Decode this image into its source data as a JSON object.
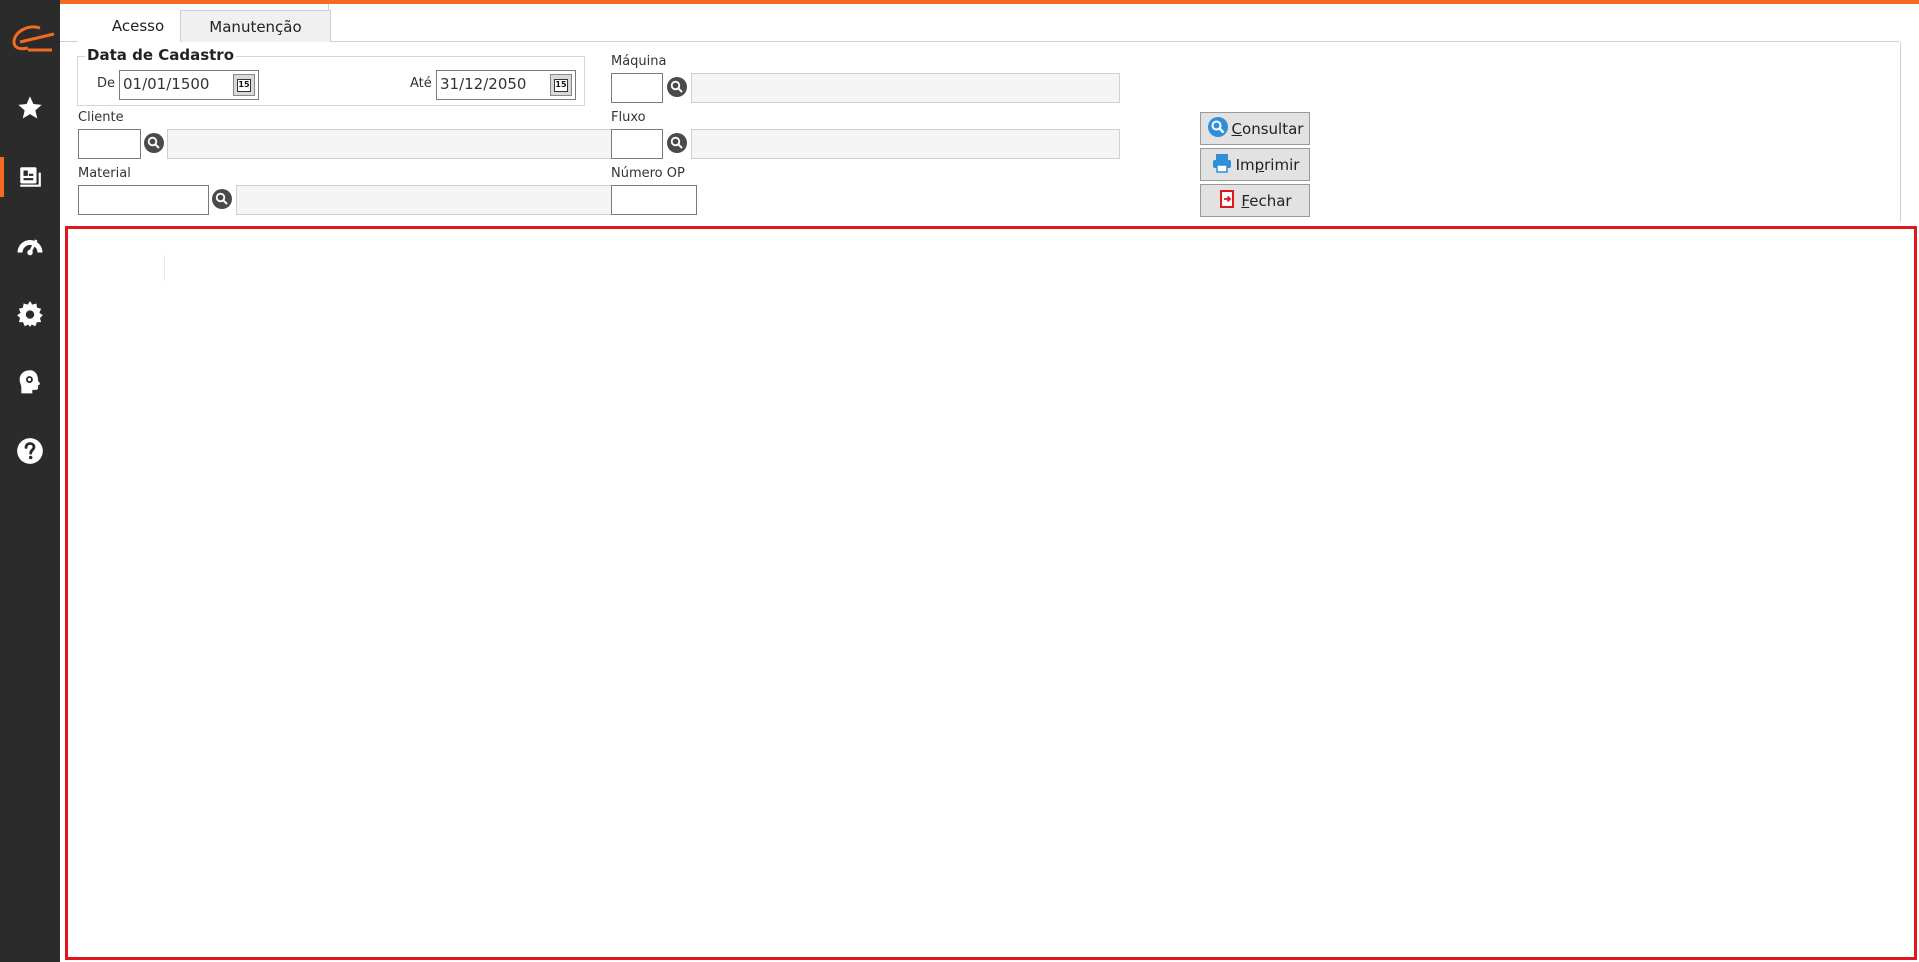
{
  "tabs": [
    {
      "label": "Acesso",
      "active": true
    },
    {
      "label": "Manutenção",
      "active": false
    }
  ],
  "filters": {
    "data_cadastro": {
      "group_label": "Data de Cadastro",
      "de_label": "De",
      "de_value": "01/01/1500",
      "ate_label": "Até",
      "ate_value": "31/12/2050"
    },
    "cliente": {
      "label": "Cliente",
      "code": "",
      "description": ""
    },
    "material": {
      "label": "Material",
      "code": "",
      "description": ""
    },
    "maquina": {
      "label": "Máquina",
      "code": "",
      "description": ""
    },
    "fluxo": {
      "label": "Fluxo",
      "code": "",
      "description": ""
    },
    "numero_op": {
      "label": "Número OP",
      "value": ""
    }
  },
  "actions": {
    "consultar": {
      "label": "Consultar",
      "mnemonic": "C"
    },
    "imprimir": {
      "label": "Imprimir",
      "mnemonic": "p"
    },
    "fechar": {
      "label": "Fechar",
      "mnemonic": "F"
    }
  },
  "colors": {
    "accent": "#f26b1f",
    "sidebar": "#2b2b2b",
    "highlight_border": "#e0161d",
    "consultar_icon": "#2f8fd8",
    "imprimir_icon": "#2f8fd8",
    "fechar_icon": "#e0161d"
  },
  "sidebar": {
    "icons": [
      "logo-icon",
      "star-icon",
      "reports-icon",
      "dashboard-icon",
      "gear-icon",
      "idea-icon",
      "help-icon"
    ],
    "active_index": 2
  }
}
